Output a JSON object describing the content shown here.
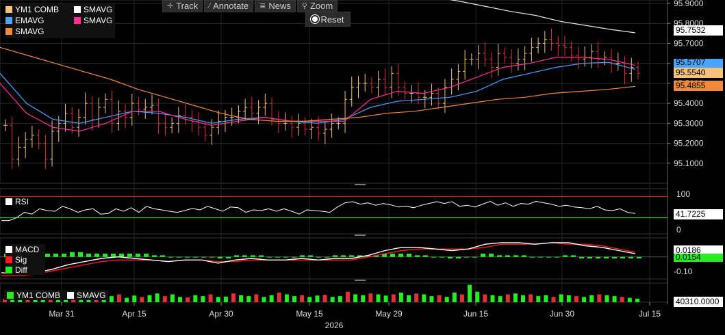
{
  "toolbar": {
    "track": "Track",
    "annotate": "Annotate",
    "news": "News",
    "zoom": "Zoom",
    "reset": "Reset"
  },
  "colors": {
    "price_bar_up": "#f4c27a",
    "price_bar_down": "#e0303a",
    "emavg": "#4aa3ff",
    "smavg_pink": "#ff2f9a",
    "smavg_orange": "#f08a3a",
    "smavg_white": "#e8e8e8",
    "rsi_line": "#ffffff",
    "rsi_upper": "#ff2020",
    "rsi_lower": "#20ff20",
    "macd": "#ffffff",
    "sig": "#ff1a1a",
    "diff": "#22ee22"
  },
  "main_legend": [
    {
      "name": "YM1 COMB",
      "color": "#f4c27a"
    },
    {
      "name": "SMAVG",
      "color": "#ffffff"
    },
    {
      "name": "EMAVG",
      "color": "#4aa3ff"
    },
    {
      "name": "SMAVG",
      "color": "#ff2f9a"
    },
    {
      "name": "SMAVG",
      "color": "#f08a3a"
    }
  ],
  "price_tags": [
    {
      "value": "95.7532",
      "bg": "#ffffff",
      "fg": "#000000"
    },
    {
      "value": "95.5707",
      "bg": "#4aa3ff",
      "fg": "#000000"
    },
    {
      "value": "95.5540",
      "bg": "#f4c27a",
      "fg": "#000000"
    },
    {
      "value": "95.4855",
      "bg": "#f08a3a",
      "fg": "#000000"
    }
  ],
  "rsi_panel": {
    "label": "RSI",
    "value": "41.7225",
    "axis": [
      "100",
      "0"
    ]
  },
  "macd_panel": {
    "legend": [
      {
        "name": "MACD",
        "color": "#ffffff"
      },
      {
        "name": "Sig",
        "color": "#ff1a1a"
      },
      {
        "name": "Diff",
        "color": "#22ee22"
      }
    ],
    "value_macd": "0.0186",
    "value_diff": "0.0154",
    "axis": [
      "-0.10"
    ]
  },
  "volume_panel": {
    "legend": [
      {
        "name": "YM1 COMB",
        "color": "#22ee22"
      },
      {
        "name": "SMAVG",
        "color": "#ffffff"
      }
    ],
    "value": "40310.0000"
  },
  "year_label": "2026",
  "chart_data": {
    "type": "line",
    "title": "",
    "price_axis": [
      "95.9000",
      "95.8000",
      "95.7000",
      "95.6000",
      "95.5000",
      "95.4000",
      "95.3000",
      "95.2000",
      "95.1000"
    ],
    "ylim": [
      95.0,
      95.9
    ],
    "x_ticks": [
      "Mar 31",
      "Apr 15",
      "Apr 30",
      "May 15",
      "May 29",
      "Jun 15",
      "Jun 30",
      "Jul 15"
    ],
    "ohlc_close": [
      95.29,
      95.12,
      95.18,
      95.22,
      95.24,
      95.2,
      95.12,
      95.26,
      95.3,
      95.35,
      95.28,
      95.33,
      95.4,
      95.32,
      95.38,
      95.42,
      95.3,
      95.36,
      95.33,
      95.4,
      95.37,
      95.38,
      95.39,
      95.3,
      95.28,
      95.3,
      95.34,
      95.33,
      95.31,
      95.28,
      95.24,
      95.28,
      95.31,
      95.33,
      95.33,
      95.36,
      95.38,
      95.35,
      95.38,
      95.4,
      95.32,
      95.3,
      95.3,
      95.28,
      95.3,
      95.27,
      95.28,
      95.25,
      95.27,
      95.3,
      95.3,
      95.42,
      95.48,
      95.5,
      95.5,
      95.48,
      95.52,
      95.48,
      95.55,
      95.48,
      95.45,
      95.45,
      95.43,
      95.43,
      95.45,
      95.4,
      95.48,
      95.52,
      95.56,
      95.62,
      95.62,
      95.65,
      95.62,
      95.58,
      95.65,
      95.63,
      95.6,
      95.62,
      95.65,
      95.68,
      95.7,
      95.72,
      95.7,
      95.69,
      95.68,
      95.64,
      95.62,
      95.63,
      95.66,
      95.62,
      95.63,
      95.6,
      95.6,
      95.55,
      95.58,
      95.55
    ],
    "series": [
      {
        "name": "SMAVG",
        "values": [
          95.96,
          95.93,
          95.91,
          95.885,
          95.86,
          95.84,
          95.81,
          95.79,
          95.77,
          95.753
        ]
      },
      {
        "name": "EMAVG",
        "values": [
          95.55,
          95.4,
          95.32,
          95.3,
          95.33,
          95.36,
          95.35,
          95.33,
          95.3,
          95.32,
          95.33,
          95.31,
          95.3,
          95.32,
          95.38,
          95.41,
          95.42,
          95.43,
          95.46,
          95.52,
          95.55,
          95.58,
          95.6,
          95.605,
          95.57
        ]
      },
      {
        "name": "SMAVG",
        "values": [
          95.5,
          95.35,
          95.28,
          95.26,
          95.3,
          95.36,
          95.36,
          95.32,
          95.29,
          95.31,
          95.33,
          95.31,
          95.31,
          95.31,
          95.42,
          95.46,
          95.45,
          95.48,
          95.53,
          95.58,
          95.6,
          95.63,
          95.63,
          95.62,
          95.59
        ]
      },
      {
        "name": "SMAVG",
        "values": [
          95.68,
          95.64,
          95.6,
          95.56,
          95.52,
          95.47,
          95.43,
          95.39,
          95.35,
          95.32,
          95.31,
          95.31,
          95.32,
          95.33,
          95.35,
          95.36,
          95.38,
          95.4,
          95.42,
          95.43,
          95.45,
          95.46,
          95.47,
          95.485
        ]
      }
    ],
    "rsi": [
      22,
      22,
      30,
      45,
      40,
      55,
      50,
      48,
      62,
      55,
      45,
      52,
      55,
      40,
      42,
      55,
      48,
      58,
      45,
      62,
      55,
      52,
      48,
      45,
      50,
      56,
      52,
      62,
      55,
      48,
      60,
      58,
      45,
      52,
      50,
      55,
      48,
      55,
      48,
      40,
      52,
      50,
      48,
      45,
      60,
      72,
      75,
      68,
      72,
      65,
      70,
      66,
      60,
      62,
      58,
      65,
      70,
      75,
      70,
      75,
      62,
      65,
      60,
      68,
      76,
      65,
      72,
      62,
      70,
      68,
      76,
      72,
      68,
      62,
      65,
      60,
      58,
      55,
      62,
      52,
      50,
      55,
      45,
      42
    ],
    "macd": [
      -0.1,
      -0.11,
      -0.1,
      -0.08,
      -0.05,
      -0.03,
      -0.01,
      0.0,
      -0.01,
      -0.02,
      -0.03,
      -0.02,
      -0.02,
      -0.04,
      -0.02,
      -0.01,
      -0.02,
      -0.02,
      -0.01,
      -0.02,
      -0.01,
      -0.01,
      0.01,
      0.04,
      0.06,
      0.06,
      0.05,
      0.04,
      0.05,
      0.08,
      0.09,
      0.09,
      0.08,
      0.09,
      0.09,
      0.07,
      0.06,
      0.04,
      0.02
    ],
    "sig": [
      -0.12,
      -0.12,
      -0.11,
      -0.09,
      -0.07,
      -0.05,
      -0.03,
      -0.02,
      -0.02,
      -0.02,
      -0.03,
      -0.02,
      -0.02,
      -0.03,
      -0.03,
      -0.02,
      -0.02,
      -0.02,
      -0.02,
      -0.02,
      -0.02,
      -0.02,
      0.0,
      0.02,
      0.04,
      0.05,
      0.05,
      0.05,
      0.05,
      0.06,
      0.08,
      0.08,
      0.08,
      0.09,
      0.08,
      0.08,
      0.07,
      0.05,
      0.03
    ],
    "diff": [
      0.02,
      0.02,
      0.02,
      0.02,
      0.03,
      0.02,
      0.02,
      0.02,
      0.02,
      0.01,
      0.0,
      0.0,
      0.0,
      -0.01,
      0.01,
      0.01,
      0.0,
      0.0,
      0.01,
      0.0,
      0.01,
      0.01,
      0.01,
      0.02,
      0.02,
      0.01,
      0.0,
      -0.01,
      0.0,
      0.02,
      0.01,
      0.01,
      0.0,
      0.0,
      0.01,
      -0.01,
      -0.01,
      -0.01,
      -0.01
    ],
    "volume": [
      20,
      35,
      25,
      40,
      30,
      28,
      45,
      50,
      35,
      40,
      30,
      38,
      42,
      30,
      35,
      45,
      25,
      38,
      30,
      40,
      50,
      35,
      45,
      30,
      28,
      40,
      35,
      45,
      30,
      32,
      50,
      40,
      35,
      45,
      30,
      40,
      55,
      45,
      35,
      40,
      30,
      38,
      42,
      30,
      35,
      60,
      45,
      40,
      50,
      45,
      38,
      45,
      55,
      40,
      50,
      45,
      35,
      40,
      30,
      55,
      45,
      100,
      60,
      45,
      40,
      35,
      45,
      50,
      40,
      45,
      35,
      40,
      30,
      45,
      40,
      35,
      30,
      40,
      45,
      40,
      35,
      30,
      25,
      20
    ]
  }
}
